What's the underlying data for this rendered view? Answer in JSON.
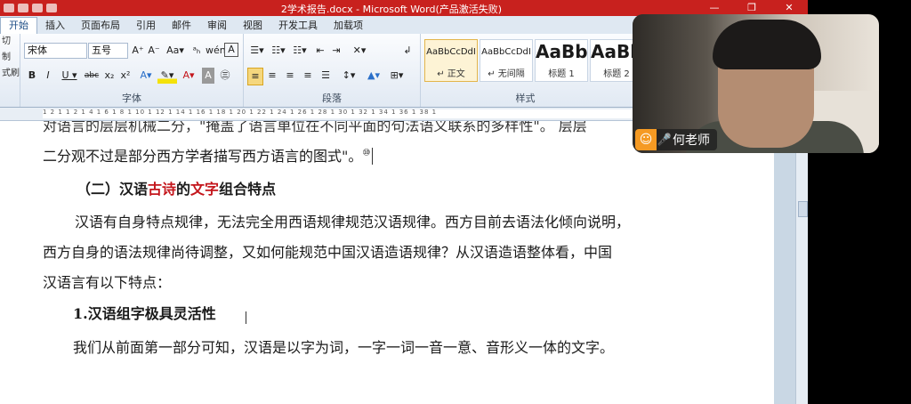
{
  "window": {
    "title": "2学术报告.docx - Microsoft Word(产品激活失败)",
    "controls": [
      "—",
      "❐",
      "✕"
    ]
  },
  "tabs": [
    "开始",
    "插入",
    "页面布局",
    "引用",
    "邮件",
    "审阅",
    "视图",
    "开发工具",
    "加载项"
  ],
  "active_tab": "开始",
  "clipboard": [
    "切",
    "制",
    "式刷"
  ],
  "font": {
    "name": "宋体",
    "size": "五号",
    "group_label": "字体",
    "row1": [
      "A⁺",
      "A⁻",
      "Aa▾",
      "ᵃₕ",
      "wén",
      "A"
    ],
    "row2": [
      "B",
      "I",
      "U ▾",
      "abc",
      "x₂",
      "x²",
      "A▾",
      "✎▾",
      "A▾",
      "A",
      "㊂"
    ]
  },
  "paragraph": {
    "group_label": "段落",
    "row1": [
      "☰▾",
      "☷▾",
      "☷▾",
      "⇤",
      "⇥",
      "✕▾",
      "↲"
    ],
    "row2": [
      "≡",
      "≡",
      "≡",
      "≡",
      "☰",
      "↕▾",
      "▲▾",
      "⊞▾"
    ]
  },
  "styles": {
    "group_label": "样式",
    "items": [
      {
        "preview": "AaBbCcDdI",
        "name": "↵ 正文",
        "selected": true
      },
      {
        "preview": "AaBbCcDdI",
        "name": "↵ 无间隔",
        "selected": false
      },
      {
        "preview": "AaBb",
        "name": "标题 1",
        "selected": false,
        "big": true
      },
      {
        "preview": "AaBb",
        "name": "标题 2",
        "selected": false,
        "big": true
      }
    ]
  },
  "ruler": {
    "ticks": "1 2 1 1 2 1 4 1 6 1 8 1 10 1 12 1 14 1 16 1 18 1 20 1 22 1 24 1 26 1 28 1 30 1 32 1 34 1 36 1 38 1"
  },
  "document": {
    "cut_line": "对语言的层层机械二分，\"掩盖了语言单位在不同平面的句法语义联系的多样性\"。     层层",
    "line_dual": "二分观不过是部分西方学者描写西方语言的图式\"。",
    "footnote_mark": "⑩",
    "heading2_parts": [
      "（二）汉语",
      "古诗",
      "的",
      "文字",
      "组合特点"
    ],
    "para1": [
      "汉语有自身特点规律，无法完全用西语规律规范汉语规律。西方目前去语法化倾向说明，",
      "西方自身的语法规律尚待调整，又如何能规范中国汉语造语规律？从汉语造语整体看，中国",
      "汉语言有以下特点："
    ],
    "heading3": "1.汉语组字极具灵活性",
    "para2": "我们从前面第一部分可知，汉语是以字为词，一字一词一音一意、音形义一体的文字。"
  },
  "meeting": {
    "speaker_name": "何老师",
    "avatar_icon": "person-icon",
    "mic_icon": "microphone-icon"
  },
  "colors": {
    "titlebar": "#c8211e",
    "highlight_red": "#c4161c"
  }
}
